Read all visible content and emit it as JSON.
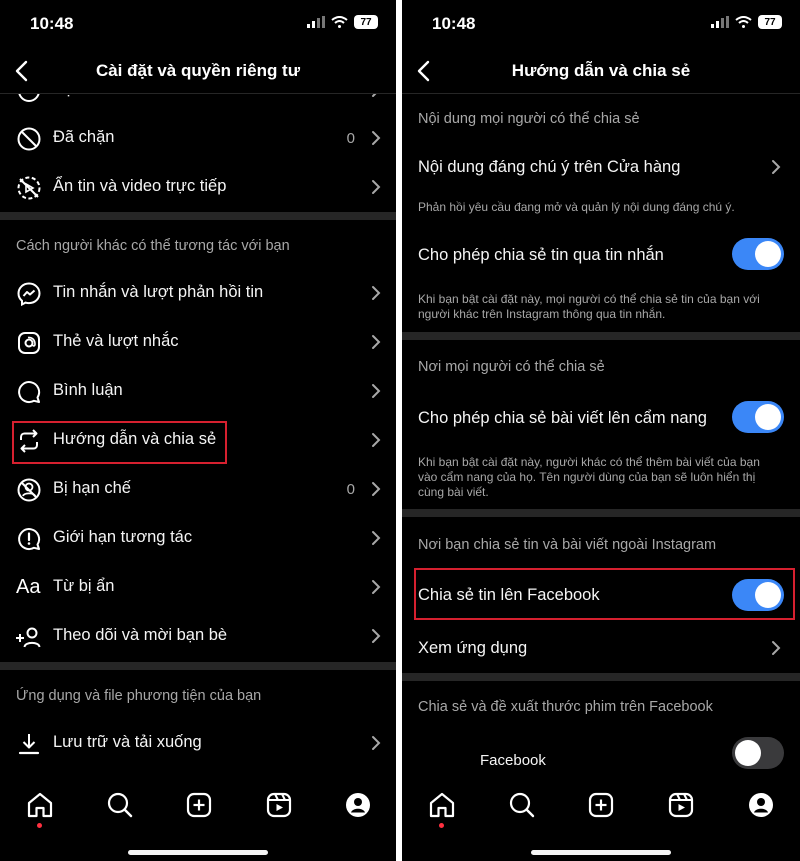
{
  "left": {
    "status": {
      "time": "10:48",
      "battery": "77"
    },
    "header": {
      "title": "Cài đặt và quyền riêng tư"
    },
    "rows_top": [
      {
        "label": "Bạn thân",
        "count": "",
        "icon": "star-list-icon"
      },
      {
        "label": "Đã chặn",
        "count": "0",
        "icon": "block-icon"
      },
      {
        "label": "Ẩn tin và video trực tiếp",
        "count": "",
        "icon": "hide-story-icon"
      }
    ],
    "section_interact": "Cách người khác có thể tương tác với bạn",
    "rows_interact": [
      {
        "label": "Tin nhắn và lượt phản hồi tin",
        "count": "",
        "icon": "messenger-icon"
      },
      {
        "label": "Thẻ và lượt nhắc",
        "count": "",
        "icon": "at-icon"
      },
      {
        "label": "Bình luận",
        "count": "",
        "icon": "comment-icon"
      },
      {
        "label": "Hướng dẫn và chia sẻ",
        "count": "",
        "icon": "share-repost-icon"
      },
      {
        "label": "Bị hạn chế",
        "count": "0",
        "icon": "restrict-icon"
      },
      {
        "label": "Giới hạn tương tác",
        "count": "",
        "icon": "alert-limit-icon"
      },
      {
        "label": "Từ bị ẩn",
        "count": "",
        "icon": "hidden-words-icon"
      },
      {
        "label": "Theo dõi và mời bạn bè",
        "count": "",
        "icon": "add-person-icon"
      }
    ],
    "section_apps": "Ứng dụng và file phương tiện của bạn",
    "rows_apps": [
      {
        "label": "Lưu trữ và tải xuống",
        "count": "",
        "icon": "download-icon"
      }
    ],
    "hidden_words_glyph": "Aa"
  },
  "right": {
    "status": {
      "time": "10:48",
      "battery": "77"
    },
    "header": {
      "title": "Hướng dẫn và chia sẻ"
    },
    "section1": "Nội dung mọi người có thể chia sẻ",
    "row_shop": {
      "label": "Nội dung đáng chú ý trên Cửa hàng"
    },
    "desc_shop": "Phản hồi yêu cầu đang mở và quản lý nội dung đáng chú ý.",
    "row_story_msg": {
      "label": "Cho phép chia sẻ tin qua tin nhắn",
      "on": true
    },
    "desc_story_msg": "Khi bạn bật cài đặt này, mọi người có thể chia sẻ tin của bạn với người khác trên Instagram thông qua tin nhắn.",
    "section2": "Nơi mọi người có thể chia sẻ",
    "row_guides": {
      "label": "Cho phép chia sẻ bài viết lên cẩm nang",
      "on": true
    },
    "desc_guides": "Khi bạn bật cài đặt này, người khác có thể thêm bài viết của bạn vào cẩm nang của họ. Tên người dùng của bạn sẽ luôn hiển thị cùng bài viết.",
    "section3": "Nơi bạn chia sẻ tin và bài viết ngoài Instagram",
    "row_fb_story": {
      "label": "Chia sẻ tin lên Facebook",
      "on": true
    },
    "row_apps": {
      "label": "Xem ứng dụng"
    },
    "section4": "Chia sẻ và đề xuất thước phim trên Facebook",
    "row_fb_reels": {
      "label": "Facebook",
      "on": false
    }
  },
  "colors": {
    "background": "#000000",
    "accent": "#3b87f7",
    "highlight": "#d6202f",
    "divider": "#262626"
  }
}
